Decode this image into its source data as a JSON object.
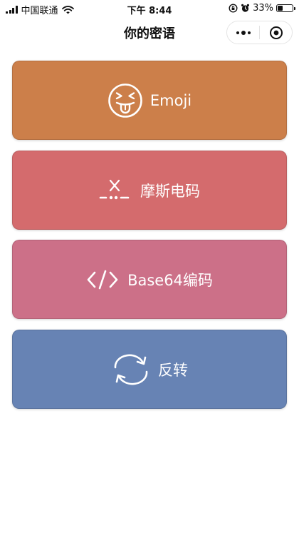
{
  "status_bar": {
    "carrier": "中国联通",
    "time": "下午 8:44",
    "battery": "33%",
    "battery_level": 0.33
  },
  "nav": {
    "title": "你的密语"
  },
  "cards": [
    {
      "label": "Emoji",
      "icon": "tongue-out-emoji-icon",
      "color": "#cc7f4a"
    },
    {
      "label": "摩斯电码",
      "icon": "morse-code-icon",
      "color": "#d46b6d"
    },
    {
      "label": "Base64编码",
      "icon": "code-brackets-icon",
      "color": "#cc7088"
    },
    {
      "label": "反转",
      "icon": "refresh-arrows-icon",
      "color": "#6783b4"
    }
  ]
}
